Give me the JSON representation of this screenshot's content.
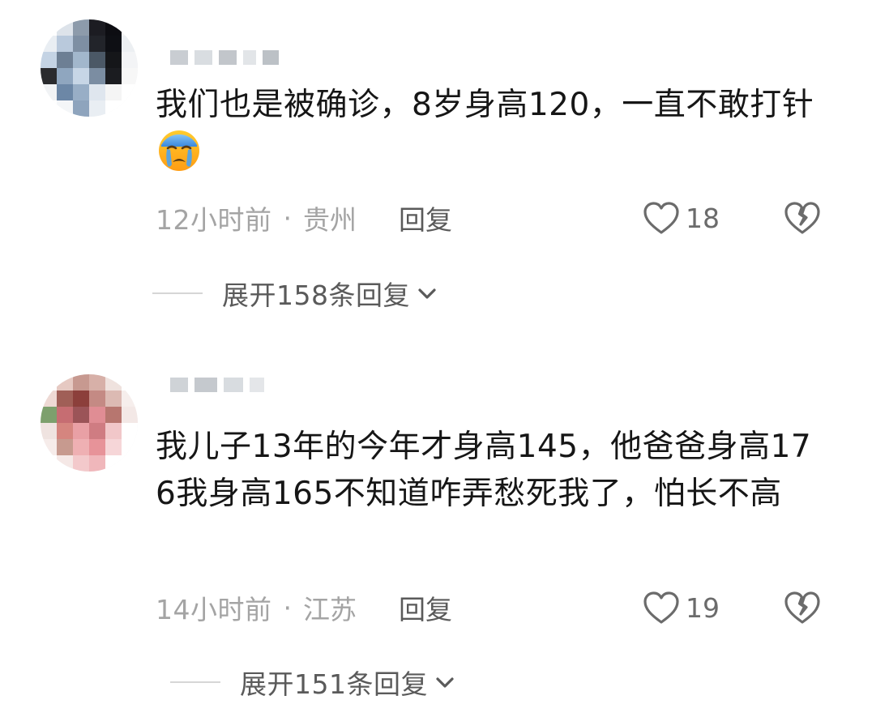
{
  "comments": [
    {
      "text": "我们也是被确诊，8岁身高120，一直不敢打针",
      "emoji": "loudly-crying-face",
      "time": "12小时前",
      "separator": "·",
      "location": "贵州",
      "reply_label": "回复",
      "likes": "18",
      "expand_label": "展开158条回复"
    },
    {
      "text": "我儿子13年的今年才身高145，他爸爸身高176我身高165不知道咋弄愁死我了，怕长不高",
      "time": "14小时前",
      "separator": "·",
      "location": "江苏",
      "reply_label": "回复",
      "likes": "19",
      "expand_label": "展开151条回复"
    }
  ],
  "colors": {
    "text_primary": "#161616",
    "text_meta": "#a4a4a4",
    "text_action": "#5a5a5a",
    "icon_gray": "#6b6b6b",
    "divider": "#d6d6d6"
  },
  "avatars": [
    {
      "pixels": [
        "#ffffff",
        "#dde3ea",
        "#8d9bab",
        "#1c1c22",
        "#0d0d12",
        "#f4f4f4",
        "#e9eef3",
        "#b9c9dc",
        "#7e8fa3",
        "#22242a",
        "#0e0f14",
        "#eceff2",
        "#c4d3e4",
        "#6d7f94",
        "#a2b7cc",
        "#4b5866",
        "#151619",
        "#f3f4f6",
        "#2a2b2e",
        "#8fa6bf",
        "#c7d6e6",
        "#7b8da2",
        "#1b1c20",
        "#f7f7f7",
        "#f1f3f5",
        "#6c87a6",
        "#98aec6",
        "#dfe6ee",
        "#f5f5f5",
        "#ffffff",
        "#ffffff",
        "#f4f6f8",
        "#8ea4bd",
        "#e9eef3",
        "#ffffff",
        "#ffffff"
      ]
    },
    {
      "pixels": [
        "#ffffff",
        "#e6c9c2",
        "#c79990",
        "#d7b0a8",
        "#efe2de",
        "#ffffff",
        "#eed9d4",
        "#a05f57",
        "#8c3f3b",
        "#c48a84",
        "#dcbab3",
        "#f6eeec",
        "#7da06d",
        "#c66d72",
        "#9b5458",
        "#e08d94",
        "#b7766f",
        "#f3e8e6",
        "#efe3e0",
        "#d5857f",
        "#e9a0a5",
        "#cf7c82",
        "#f1c7c9",
        "#ffffff",
        "#f6ecea",
        "#c79a8f",
        "#efb0b3",
        "#e79399",
        "#f6d6d8",
        "#ffffff",
        "#ffffff",
        "#f5e8e6",
        "#f3c9cb",
        "#f0b7bb",
        "#ffffff",
        "#ffffff"
      ]
    }
  ],
  "usernames": [
    {
      "blocks": [
        {
          "w": 22,
          "c": "#c9cdd2"
        },
        {
          "w": 22,
          "c": "#d9dde1"
        },
        {
          "w": 22,
          "c": "#c2c6cb"
        },
        {
          "w": 16,
          "c": "#e2e5e8"
        },
        {
          "w": 20,
          "c": "#bcc1c6"
        }
      ]
    },
    {
      "blocks": [
        {
          "w": 22,
          "c": "#cfd3d7"
        },
        {
          "w": 28,
          "c": "#c5c9ce"
        },
        {
          "w": 24,
          "c": "#d8dce0"
        },
        {
          "w": 18,
          "c": "#e4e6e9"
        }
      ]
    }
  ]
}
